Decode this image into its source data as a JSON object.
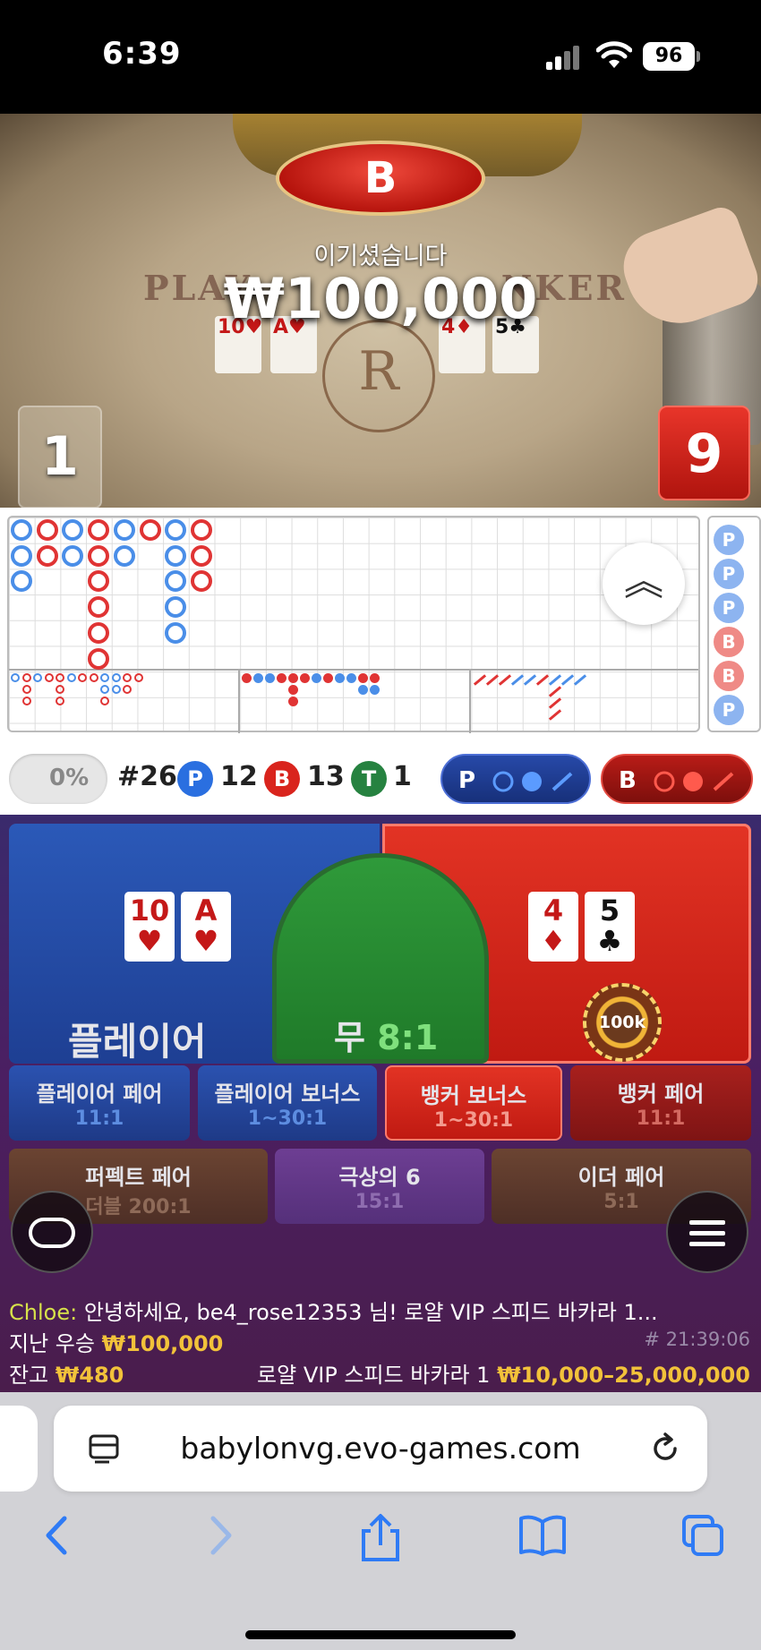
{
  "status_bar": {
    "time": "6:39",
    "battery": "96"
  },
  "video": {
    "result_badge": "B",
    "win_message": "이기셨습니다",
    "win_amount": "₩100,000",
    "table_print_left": "PLAY",
    "table_print_right": "NKER",
    "player_cards": [
      "10♥",
      "A♥"
    ],
    "banker_cards": [
      "4♦",
      "5♣"
    ],
    "player_score": "1",
    "banker_score": "9"
  },
  "roadmap": {
    "predict_items": [
      "P",
      "P",
      "P",
      "B",
      "B",
      "P"
    ]
  },
  "stats": {
    "toggle_percent": "0%",
    "round": "#26",
    "player_badge": "P",
    "player_count": "12",
    "banker_badge": "B",
    "banker_count": "13",
    "tie_badge": "T",
    "tie_count": "1",
    "player_predict": "P",
    "banker_predict": "B"
  },
  "bet": {
    "player_label": "플레이어",
    "tie_label": "무",
    "tie_odds": "8:1",
    "player_cards": [
      {
        "rank": "10",
        "suit": "♥",
        "color": "red"
      },
      {
        "rank": "A",
        "suit": "♥",
        "color": "red"
      }
    ],
    "banker_cards": [
      {
        "rank": "4",
        "suit": "♦",
        "color": "red"
      },
      {
        "rank": "5",
        "suit": "♣",
        "color": "black"
      }
    ],
    "chip_value": "100k",
    "side_bets": [
      {
        "name": "플레이어 페어",
        "odds": "11:1"
      },
      {
        "name": "플레이어 보너스",
        "odds": "1~30:1"
      },
      {
        "name": "뱅커 보너스",
        "odds": "1~30:1"
      },
      {
        "name": "뱅커 페어",
        "odds": "11:1"
      },
      {
        "name": "퍼펙트 페어",
        "odds": "더블 200:1"
      },
      {
        "name": "극상의 6",
        "odds": "15:1"
      },
      {
        "name": "이더 페어",
        "odds": "5:1"
      }
    ]
  },
  "chat": {
    "user": "Chloe:",
    "message": "안녕하세요, be4_rose12353 님! 로얄 VIP 스피드 바카라 1...",
    "last_win_label": "지난 우승",
    "last_win_amount": "₩100,000",
    "round_id": "# 21:39:06",
    "balance_label": "잔고",
    "balance_amount": "₩480",
    "table_name": "로얄 VIP 스피드 바카라 1",
    "limits": "₩10,000–25,000,000"
  },
  "browser": {
    "url": "babylonvg.evo-games.com"
  },
  "colors": {
    "player_blue": "#2b59b8",
    "banker_red": "#e23324",
    "tie_green": "#2f9a3a",
    "gold": "#f2c23a"
  }
}
